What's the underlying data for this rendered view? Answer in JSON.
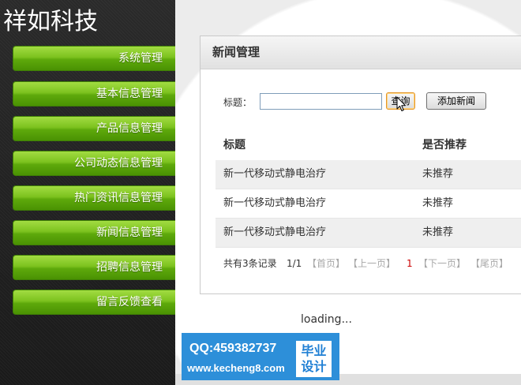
{
  "sidebar": {
    "title": "祥如科技",
    "menu": [
      {
        "label": "系统管理"
      },
      {
        "label": "基本信息管理"
      },
      {
        "label": "产品信息管理"
      },
      {
        "label": "公司动态信息管理"
      },
      {
        "label": "热门资讯信息管理"
      },
      {
        "label": "新闻信息管理"
      },
      {
        "label": "招聘信息管理"
      },
      {
        "label": "留言反馈查看"
      }
    ]
  },
  "panel": {
    "title": "新闻管理",
    "search": {
      "label": "标题：",
      "query_label": "查询",
      "add_label": "添加新闻"
    },
    "table": {
      "columns": [
        "标题",
        "是否推荐"
      ],
      "rows": [
        {
          "title": "新一代移动式静电治疗",
          "recommended": "未推荐"
        },
        {
          "title": "新一代移动式静电治疗",
          "recommended": "未推荐"
        },
        {
          "title": "新一代移动式静电治疗",
          "recommended": "未推荐"
        }
      ]
    },
    "pagination": {
      "total": "共有3条记录",
      "page": "1/1",
      "first": "【首页】",
      "prev": "【上一页】",
      "current": "1",
      "next": "【下一页】",
      "last": "【尾页】"
    }
  },
  "status": {
    "loading": "loading..."
  },
  "watermark": {
    "qq": "QQ:459382737",
    "site": "www.kecheng8.com",
    "badge_line1": "毕业",
    "badge_line2": "设计"
  },
  "icons": {
    "cursor": "mouse-cursor-icon"
  },
  "colors": {
    "sidebar_bg": "#222222",
    "menu_green": "#6cb816",
    "input_border": "#7f9db9",
    "current_page_red": "#cc0000",
    "watermark_blue": "#2d8fd9"
  }
}
